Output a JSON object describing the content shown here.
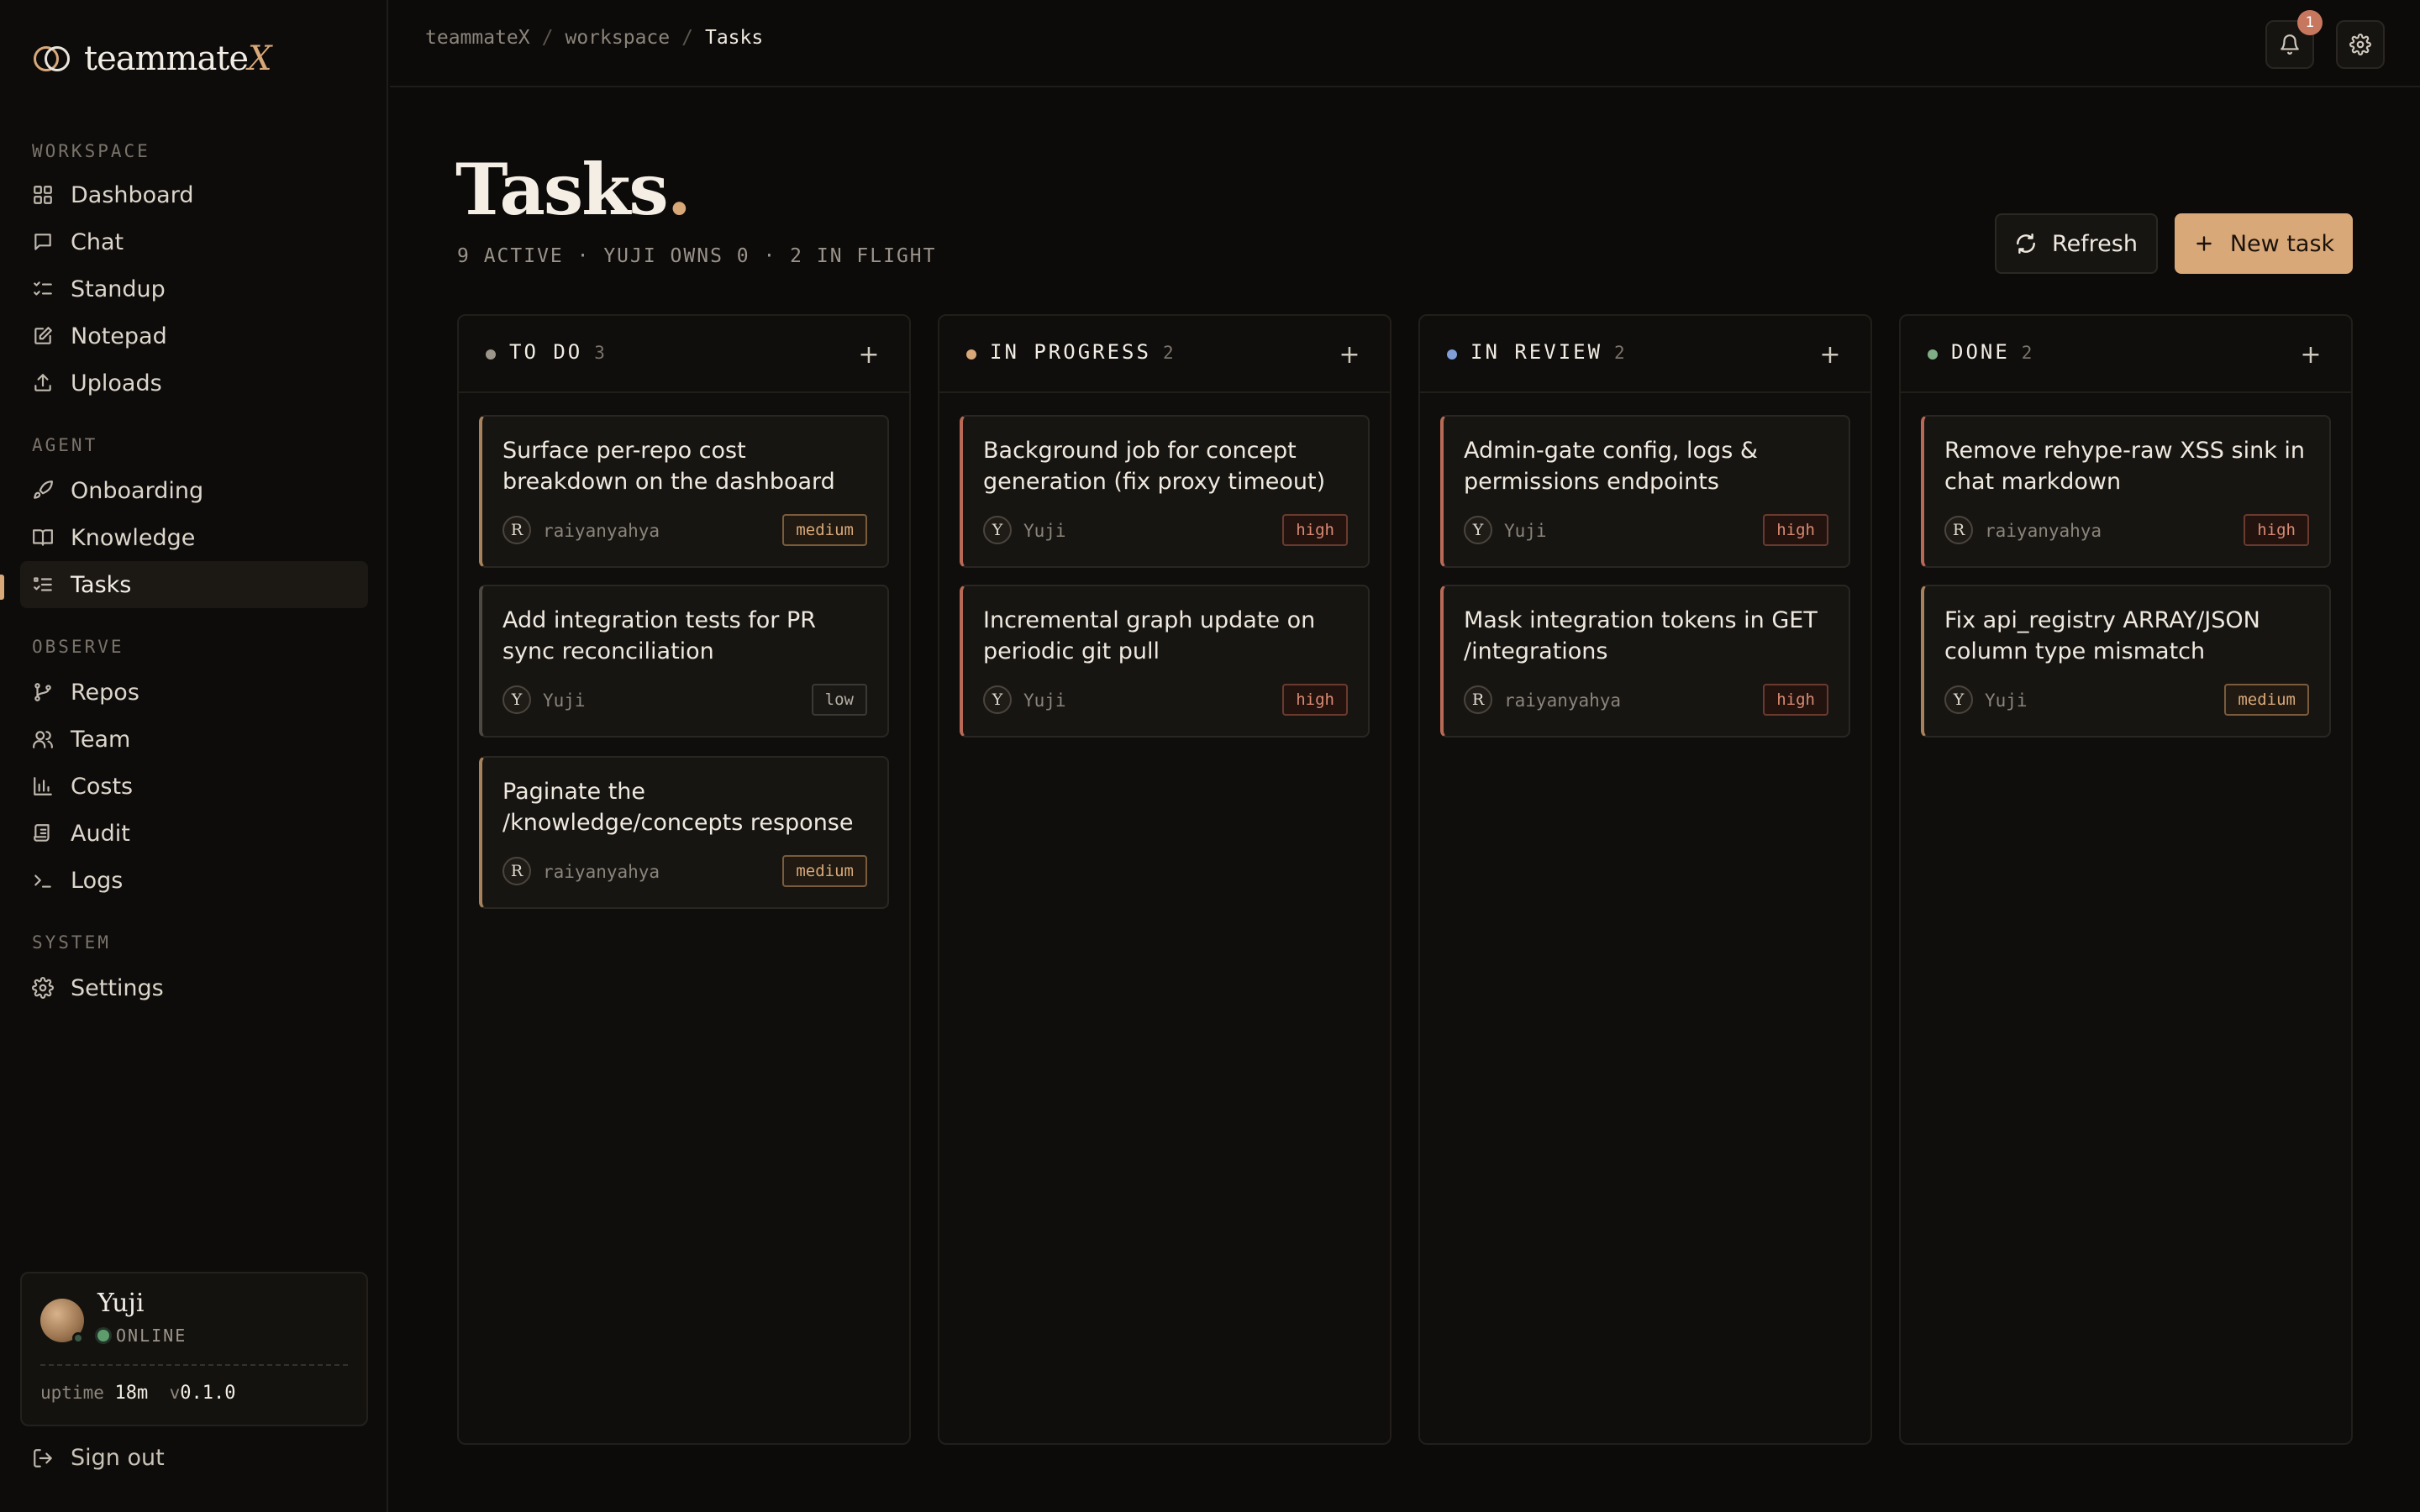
{
  "brand": {
    "name": "teammate",
    "suffix": "X"
  },
  "sidebar": {
    "sections": [
      {
        "title": "WORKSPACE"
      },
      {
        "title": "AGENT"
      },
      {
        "title": "OBSERVE"
      },
      {
        "title": "SYSTEM"
      }
    ],
    "items": [
      {
        "label": "Dashboard",
        "icon": "grid-icon"
      },
      {
        "label": "Chat",
        "icon": "chat-icon"
      },
      {
        "label": "Standup",
        "icon": "checklist-icon"
      },
      {
        "label": "Notepad",
        "icon": "edit-icon"
      },
      {
        "label": "Uploads",
        "icon": "upload-icon"
      },
      {
        "label": "Onboarding",
        "icon": "rocket-icon"
      },
      {
        "label": "Knowledge",
        "icon": "book-icon"
      },
      {
        "label": "Tasks",
        "icon": "list-check-icon",
        "active": true
      },
      {
        "label": "Repos",
        "icon": "branch-icon"
      },
      {
        "label": "Team",
        "icon": "users-icon"
      },
      {
        "label": "Costs",
        "icon": "bar-chart-icon"
      },
      {
        "label": "Audit",
        "icon": "scroll-icon"
      },
      {
        "label": "Logs",
        "icon": "terminal-icon"
      },
      {
        "label": "Settings",
        "icon": "gear-icon"
      }
    ],
    "user": {
      "name": "Yuji",
      "status": "ONLINE",
      "uptime_label": "uptime",
      "uptime_value": "18m",
      "version_prefix": "v",
      "version_value": "0.1.0"
    },
    "signout_label": "Sign out"
  },
  "topbar": {
    "breadcrumb": [
      "teammateX",
      "workspace",
      "Tasks"
    ],
    "breadcrumb_sep": "/",
    "notification_count": "1"
  },
  "page": {
    "title": "Tasks",
    "title_dot": ".",
    "subtitle": "9 ACTIVE · YUJI OWNS 0 · 2 IN FLIGHT",
    "refresh_label": "Refresh",
    "new_task_label": "New task"
  },
  "colors": {
    "accent": "#d9a878",
    "todo": "#9c958b",
    "in_progress": "#d9a878",
    "in_review": "#7f9fd6",
    "done": "#7fae86",
    "high": "#d98a72",
    "medium": "#d9a878",
    "low": "#b5aea3"
  },
  "board": {
    "add_glyph": "+",
    "columns": [
      {
        "title": "TO DO",
        "count": "3",
        "cards": [
          {
            "title": "Surface per-repo cost breakdown on the dashboard",
            "initial": "R",
            "owner": "raiyanyahya",
            "priority": "medium"
          },
          {
            "title": "Add integration tests for PR sync reconciliation",
            "initial": "Y",
            "owner": "Yuji",
            "priority": "low"
          },
          {
            "title": "Paginate the /knowledge/concepts response",
            "initial": "R",
            "owner": "raiyanyahya",
            "priority": "medium"
          }
        ]
      },
      {
        "title": "IN PROGRESS",
        "count": "2",
        "cards": [
          {
            "title": "Background job for concept generation (fix proxy timeout)",
            "initial": "Y",
            "owner": "Yuji",
            "priority": "high"
          },
          {
            "title": "Incremental graph update on periodic git pull",
            "initial": "Y",
            "owner": "Yuji",
            "priority": "high"
          }
        ]
      },
      {
        "title": "IN REVIEW",
        "count": "2",
        "cards": [
          {
            "title": "Admin-gate config, logs & permissions endpoints",
            "initial": "Y",
            "owner": "Yuji",
            "priority": "high"
          },
          {
            "title": "Mask integration tokens in GET /integrations",
            "initial": "R",
            "owner": "raiyanyahya",
            "priority": "high"
          }
        ]
      },
      {
        "title": "DONE",
        "count": "2",
        "cards": [
          {
            "title": "Remove rehype-raw XSS sink in chat markdown",
            "initial": "R",
            "owner": "raiyanyahya",
            "priority": "high"
          },
          {
            "title": "Fix api_registry ARRAY/JSON column type mismatch",
            "initial": "Y",
            "owner": "Yuji",
            "priority": "medium"
          }
        ]
      }
    ]
  }
}
